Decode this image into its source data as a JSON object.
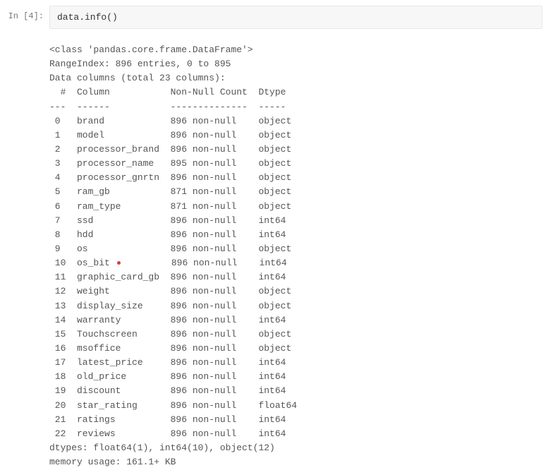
{
  "prompt": "In [4]:",
  "code": "data.info()",
  "output": {
    "class_line": "<class 'pandas.core.frame.DataFrame'>",
    "range_index": "RangeIndex: 896 entries, 0 to 895",
    "data_columns": "Data columns (total 23 columns):",
    "header_num": " #",
    "header_col": "Column",
    "header_nn": "Non-Null Count",
    "header_dtype": "Dtype",
    "sep_num": "---",
    "sep_col": "------",
    "sep_nn": "--------------",
    "sep_dtype": "-----",
    "rows": [
      {
        "n": " 0",
        "col": "brand",
        "nn": "896 non-null",
        "dt": "object"
      },
      {
        "n": " 1",
        "col": "model",
        "nn": "896 non-null",
        "dt": "object"
      },
      {
        "n": " 2",
        "col": "processor_brand",
        "nn": "896 non-null",
        "dt": "object"
      },
      {
        "n": " 3",
        "col": "processor_name",
        "nn": "895 non-null",
        "dt": "object"
      },
      {
        "n": " 4",
        "col": "processor_gnrtn",
        "nn": "896 non-null",
        "dt": "object"
      },
      {
        "n": " 5",
        "col": "ram_gb",
        "nn": "871 non-null",
        "dt": "object"
      },
      {
        "n": " 6",
        "col": "ram_type",
        "nn": "871 non-null",
        "dt": "object"
      },
      {
        "n": " 7",
        "col": "ssd",
        "nn": "896 non-null",
        "dt": "int64"
      },
      {
        "n": " 8",
        "col": "hdd",
        "nn": "896 non-null",
        "dt": "int64"
      },
      {
        "n": " 9",
        "col": "os",
        "nn": "896 non-null",
        "dt": "object"
      },
      {
        "n": " 10",
        "col": "os_bit",
        "nn": "896 non-null",
        "dt": "int64",
        "cursor": true
      },
      {
        "n": " 11",
        "col": "graphic_card_gb",
        "nn": "896 non-null",
        "dt": "int64"
      },
      {
        "n": " 12",
        "col": "weight",
        "nn": "896 non-null",
        "dt": "object"
      },
      {
        "n": " 13",
        "col": "display_size",
        "nn": "896 non-null",
        "dt": "object"
      },
      {
        "n": " 14",
        "col": "warranty",
        "nn": "896 non-null",
        "dt": "int64"
      },
      {
        "n": " 15",
        "col": "Touchscreen",
        "nn": "896 non-null",
        "dt": "object"
      },
      {
        "n": " 16",
        "col": "msoffice",
        "nn": "896 non-null",
        "dt": "object"
      },
      {
        "n": " 17",
        "col": "latest_price",
        "nn": "896 non-null",
        "dt": "int64"
      },
      {
        "n": " 18",
        "col": "old_price",
        "nn": "896 non-null",
        "dt": "int64"
      },
      {
        "n": " 19",
        "col": "discount",
        "nn": "896 non-null",
        "dt": "int64"
      },
      {
        "n": " 20",
        "col": "star_rating",
        "nn": "896 non-null",
        "dt": "float64"
      },
      {
        "n": " 21",
        "col": "ratings",
        "nn": "896 non-null",
        "dt": "int64"
      },
      {
        "n": " 22",
        "col": "reviews",
        "nn": "896 non-null",
        "dt": "int64"
      }
    ],
    "dtypes_line": "dtypes: float64(1), int64(10), object(12)",
    "memory_line": "memory usage: 161.1+ KB"
  }
}
